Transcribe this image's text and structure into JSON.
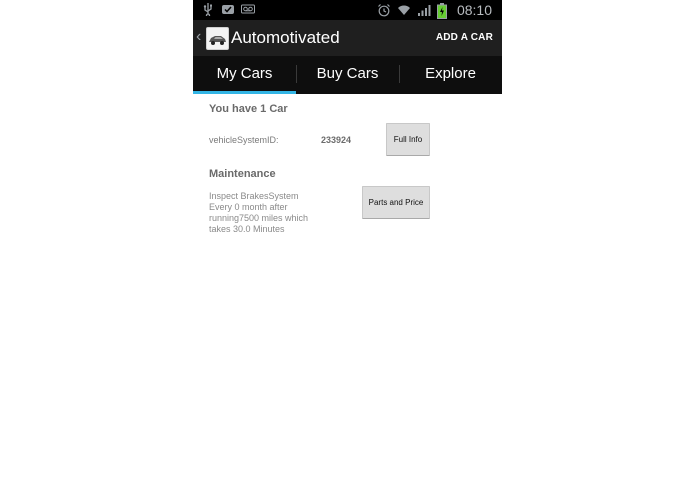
{
  "status_bar": {
    "time": "08:10",
    "icons_left": [
      "usb-icon",
      "notification-icon",
      "voicemail-icon"
    ],
    "icons_right": [
      "alarm-icon",
      "wifi-icon",
      "signal-icon",
      "battery-icon"
    ]
  },
  "action_bar": {
    "title": "Automotivated",
    "action_label": "ADD A CAR",
    "up_glyph": "‹"
  },
  "tabs": [
    {
      "label": "My Cars",
      "active": true
    },
    {
      "label": "Buy Cars",
      "active": false
    },
    {
      "label": "Explore",
      "active": false
    }
  ],
  "cars": {
    "count_text": "You have 1 Car",
    "system_id_label": "vehicleSystemID:",
    "system_id_value": "233924",
    "full_info_button": "Full Info"
  },
  "maintenance": {
    "title": "Maintenance",
    "line1": "Inspect BrakesSystem",
    "line2": "Every 0 month after",
    "line3": "running7500 miles which",
    "line4": "takes 30.0 Minutes",
    "parts_button": "Parts and Price"
  },
  "colors": {
    "tab_indicator": "#33b5e5",
    "action_bar_bg": "#1f1f1f",
    "tab_bar_bg": "#0e0e0e"
  }
}
